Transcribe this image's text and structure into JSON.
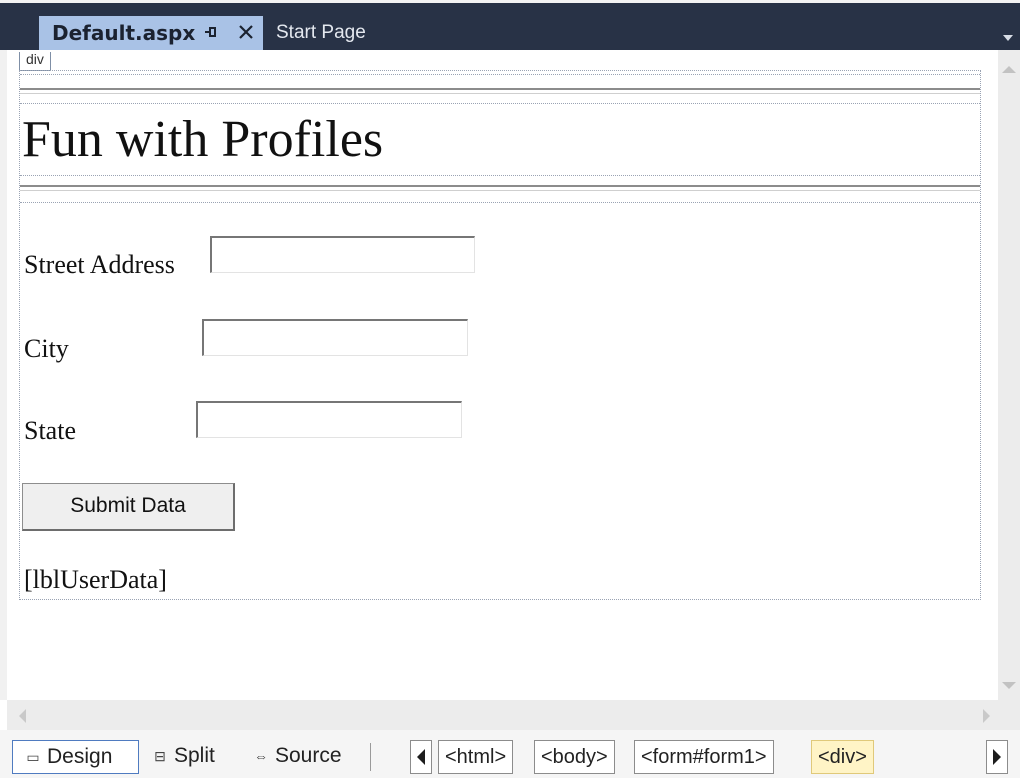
{
  "tabs": {
    "active": "Default.aspx",
    "inactive": "Start Page"
  },
  "design": {
    "div_tag": "div",
    "title": "Fun with Profiles",
    "fields": [
      {
        "label": "Street Address",
        "value": ""
      },
      {
        "label": "City",
        "value": ""
      },
      {
        "label": "State",
        "value": ""
      }
    ],
    "submit_label": "Submit Data",
    "label_placeholder": "[lblUserData]"
  },
  "views": {
    "design": "Design",
    "split": "Split",
    "source": "Source",
    "active": "Design"
  },
  "breadcrumbs": [
    "<html>",
    "<body>",
    "<form#form1>",
    "<div>"
  ],
  "colors": {
    "tab_bar": "#283246",
    "active_tab": "#a9c2e6",
    "selected_crumb": "#fff4c6"
  }
}
